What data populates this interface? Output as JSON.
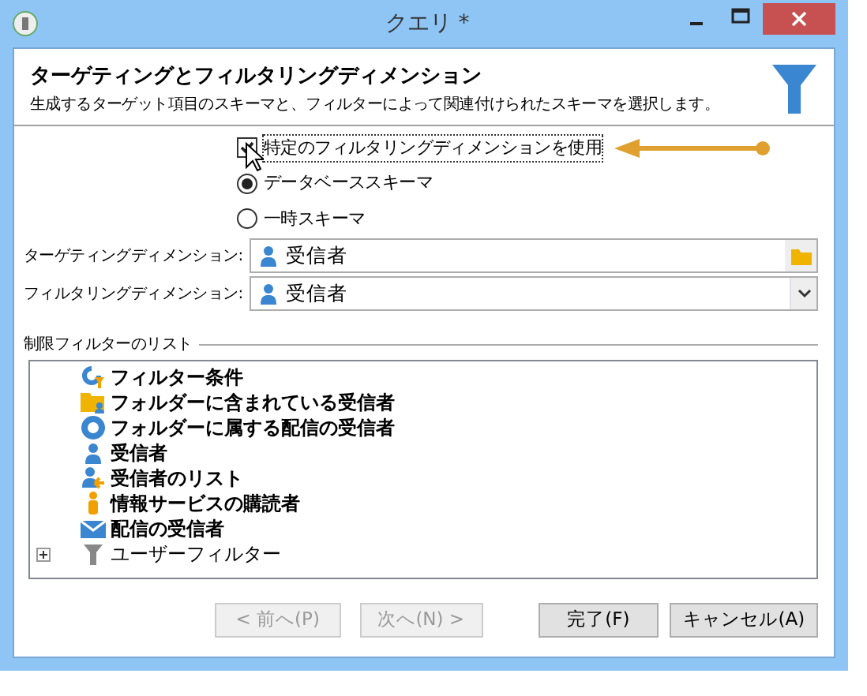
{
  "window": {
    "title": "クエリ *"
  },
  "header": {
    "title": "ターゲティングとフィルタリングディメンション",
    "subtitle": "生成するターゲット項目のスキーマと、フィルターによって関連付けられたスキーマを選択します。"
  },
  "use_filtering": {
    "label": "特定のフィルタリングディメンションを使用",
    "checked": true
  },
  "schema_options": [
    {
      "label": "データベーススキーマ",
      "selected": true
    },
    {
      "label": "一時スキーマ",
      "selected": false
    }
  ],
  "fields": [
    {
      "label": "ターゲティングディメンション:",
      "value": "受信者",
      "kind": "folder"
    },
    {
      "label": "フィルタリングディメンション:",
      "value": "受信者",
      "kind": "dropdown"
    }
  ],
  "filter_list": {
    "title": "制限フィルターのリスト",
    "items": [
      {
        "label": "フィルター条件",
        "kind": "condition"
      },
      {
        "label": "フォルダーに含まれている受信者",
        "kind": "folder"
      },
      {
        "label": "フォルダーに属する配信の受信者",
        "kind": "ring"
      },
      {
        "label": "受信者",
        "kind": "person"
      },
      {
        "label": "受信者のリスト",
        "kind": "list"
      },
      {
        "label": "情報サービスの購読者",
        "kind": "subscriber"
      },
      {
        "label": "配信の受信者",
        "kind": "mail"
      },
      {
        "label": "ユーザーフィルター",
        "kind": "funnel",
        "expanded": false
      }
    ]
  },
  "buttons": [
    {
      "label": "< 前へ(P)",
      "disabled": true
    },
    {
      "label": "次へ(N) >",
      "disabled": true
    },
    {
      "label": "完了(F)",
      "disabled": false
    },
    {
      "label": "キャンセル(A)",
      "disabled": false
    }
  ]
}
